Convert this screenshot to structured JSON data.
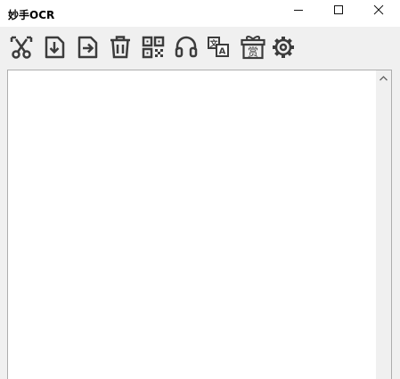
{
  "window": {
    "title": "妙手OCR"
  },
  "title_controls": [
    {
      "name": "minimize-button",
      "icon": "minimize-icon"
    },
    {
      "name": "maximize-button",
      "icon": "maximize-icon"
    },
    {
      "name": "close-button",
      "icon": "close-icon"
    }
  ],
  "toolbar": {
    "items": [
      {
        "name": "screenshot-button",
        "icon": "scissors-icon"
      },
      {
        "name": "open-file-button",
        "icon": "file-download-icon"
      },
      {
        "name": "export-button",
        "icon": "file-export-icon"
      },
      {
        "name": "clear-button",
        "icon": "trash-icon"
      },
      {
        "name": "qrcode-button",
        "icon": "qrcode-icon"
      },
      {
        "name": "support-button",
        "icon": "headset-icon"
      },
      {
        "name": "translate-button",
        "icon": "translate-icon"
      },
      {
        "name": "reward-button",
        "icon": "gift-icon",
        "label": "赏"
      },
      {
        "name": "settings-button",
        "icon": "gear-icon"
      }
    ]
  },
  "editor": {
    "text": ""
  },
  "colors": {
    "icon": "#3c3c3c",
    "background": "#f0f0f0",
    "editor_bg": "#ffffff"
  }
}
